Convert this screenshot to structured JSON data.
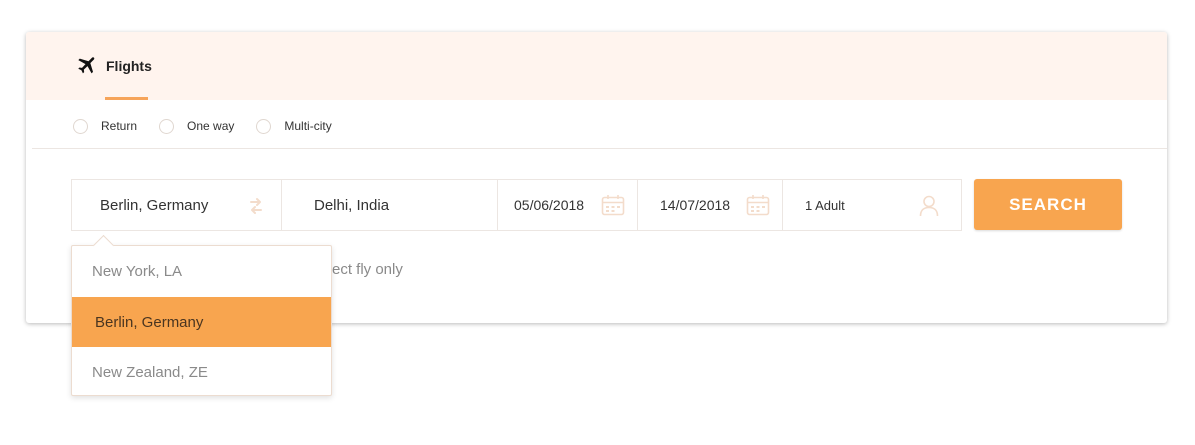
{
  "tabs": [
    {
      "label": "Flights",
      "icon": "airplane-icon",
      "active": true
    }
  ],
  "trip_types": [
    {
      "label": "Return",
      "checked": false
    },
    {
      "label": "One way",
      "checked": false
    },
    {
      "label": "Multi-city",
      "checked": false
    }
  ],
  "search": {
    "from": "Berlin, Germany",
    "to": "Delhi, India",
    "depart_date": "05/06/2018",
    "return_date": "14/07/2018",
    "passengers": "1 Adult",
    "button_label": "SEARCH"
  },
  "direct_fly_label": "rect fly only",
  "dropdown": {
    "items": [
      "New York, LA",
      "Berlin, Germany",
      "New Zealand, ZE"
    ],
    "selected": "Berlin, Germany"
  },
  "colors": {
    "accent": "#f8a54f",
    "header_bg": "#fff4ee",
    "border": "#ece6e2",
    "icon_muted": "#f3dccb"
  }
}
